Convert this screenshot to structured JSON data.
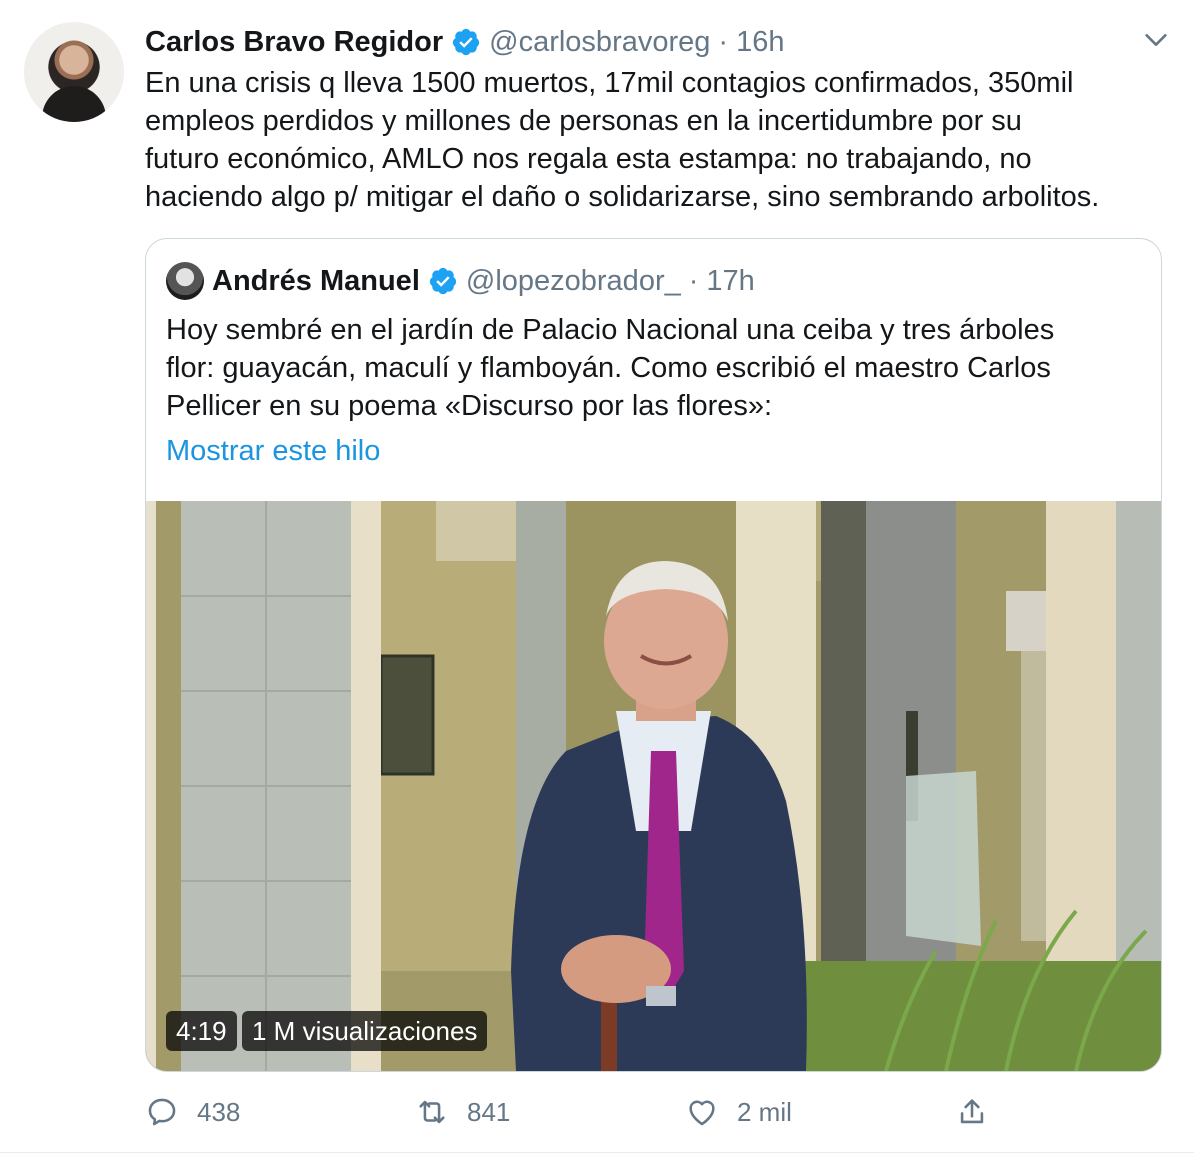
{
  "tweet": {
    "author_name": "Carlos Bravo Regidor",
    "handle": "@carlosbravoreg",
    "separator": "·",
    "time": "16h",
    "text": "En una crisis q lleva 1500 muertos, 17mil contagios confirmados, 350mil\nempleos perdidos y millones de personas en la incertidumbre por su\nfuturo económico, AMLO nos regala esta estampa: no trabajando, no\nhaciendo algo p/ mitigar el daño o solidarizarse, sino sembrando arbolitos."
  },
  "quote": {
    "author_name": "Andrés Manuel",
    "handle": "@lopezobrador_",
    "separator": "·",
    "time": "17h",
    "text": "Hoy sembré en el jardín de Palacio Nacional una ceiba y tres árboles\nflor: guayacán, maculí y flamboyán. Como escribió el maestro Carlos\nPellicer en su poema «Discurso por las flores»:",
    "thread_link": "Mostrar este hilo",
    "video": {
      "duration": "4:19",
      "views": "1 M visualizaciones"
    }
  },
  "actions": {
    "replies": "438",
    "retweets": "841",
    "likes": "2 mil"
  },
  "colors": {
    "link": "#1b95e0",
    "verified": "#1da1f2",
    "muted": "#657786",
    "border": "#ccd6dd"
  },
  "icons": [
    "verified-badge-icon",
    "chevron-down-icon",
    "reply-icon",
    "retweet-icon",
    "like-icon",
    "share-icon"
  ]
}
